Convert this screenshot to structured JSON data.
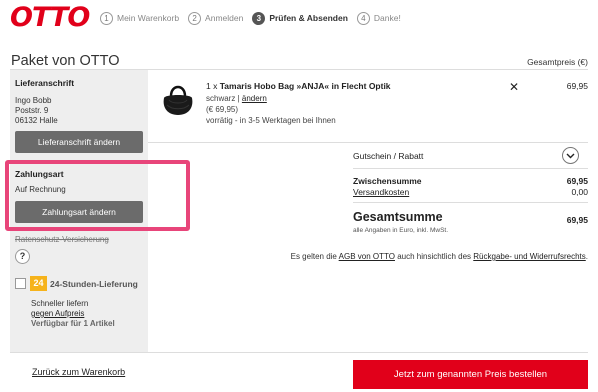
{
  "logo": "OTTO",
  "steps": [
    {
      "num": "1",
      "label": "Mein Warenkorb"
    },
    {
      "num": "2",
      "label": "Anmelden"
    },
    {
      "num": "3",
      "label": "Prüfen & Absenden"
    },
    {
      "num": "4",
      "label": "Danke!"
    }
  ],
  "page_title": "Paket von OTTO",
  "total_price_label": "Gesamtpreis (€)",
  "sidebar": {
    "address_heading": "Lieferanschrift",
    "address_lines": [
      "Ingo Bobb",
      "Poststr. 9",
      "06132 Halle"
    ],
    "address_button": "Lieferanschrift ändern",
    "payment_heading": "Zahlungsart",
    "payment_value": "Auf Rechnung",
    "payment_button": "Zahlungsart ändern",
    "insurance": "Ratenschutz-Versicherung",
    "help_symbol": "?",
    "delivery_badge": "24",
    "delivery_title": "24-Stunden-Lieferung",
    "delivery_line1": "Schneller liefern",
    "delivery_link": "gegen Aufpreis",
    "delivery_line3": "Verfügbar für 1 Artikel"
  },
  "product": {
    "qty": "1 x",
    "name": "Tamaris Hobo Bag »ANJA« in Flecht Optik",
    "color": "schwarz",
    "separator": "|",
    "change_link": "ändern",
    "unit_price": "(€ 69,95)",
    "availability": "vorrätig - in 3-5 Werktagen bei Ihnen",
    "remove_symbol": "✕",
    "price": "69,95"
  },
  "voucher_label": "Gutschein / Rabatt",
  "subtotal_label": "Zwischensumme",
  "subtotal_value": "69,95",
  "shipping_label": "Versandkosten",
  "shipping_value": "0,00",
  "grand_total_label": "Gesamtsumme",
  "grand_total_value": "69,95",
  "grand_total_note": "alle Angaben in Euro, inkl. MwSt.",
  "agb": {
    "prefix": "Es gelten die",
    "link1": "AGB von OTTO",
    "middle": "auch hinsichtlich des",
    "link2": "Rückgabe- und Widerrufsrechts",
    "suffix": "."
  },
  "footer": {
    "back_link": "Zurück zum Warenkorb",
    "order_button": "Jetzt zum genannten Preis bestellen"
  },
  "colors": {
    "brand_red": "#e1001a",
    "highlight_pink": "#e8457a",
    "badge_yellow": "#f6b31b",
    "button_gray": "#6b6b6b"
  }
}
